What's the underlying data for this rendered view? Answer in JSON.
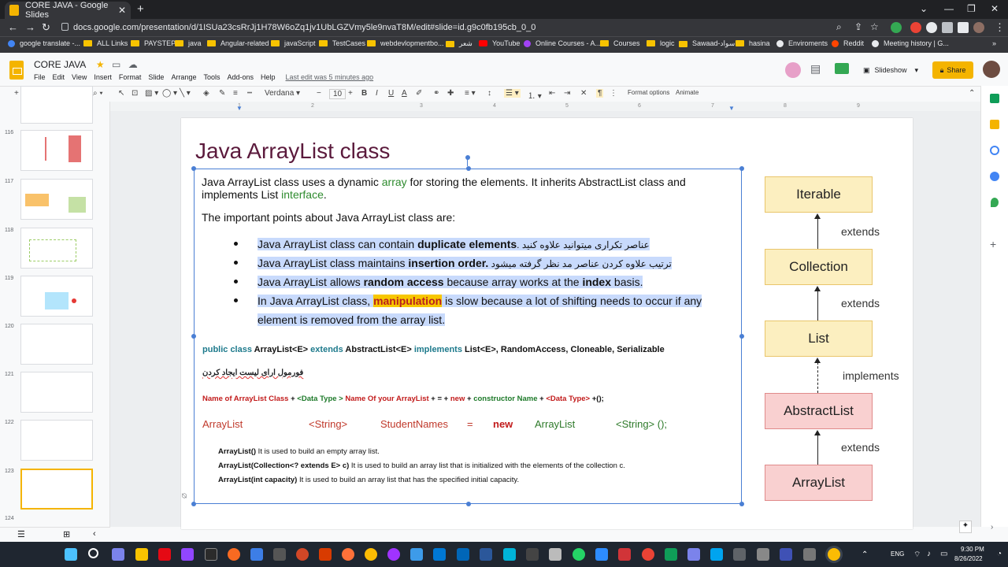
{
  "browser": {
    "tab_title": "CORE JAVA - Google Slides",
    "url": "docs.google.com/presentation/d/1ISUa23csRrJj1H78W6oZq1jv1UbLGZVmy5le9nvaT8M/edit#slide=id.g9c0fb195cb_0_0",
    "new_tab": "+",
    "tab_close": "✕"
  },
  "bookmarks": [
    {
      "label": "google translate -..."
    },
    {
      "label": "ALL Links"
    },
    {
      "label": "PAYSTEP"
    },
    {
      "label": "java"
    },
    {
      "label": "Angular-related"
    },
    {
      "label": "javaScript"
    },
    {
      "label": "TestCases"
    },
    {
      "label": "webdevlopmentbo..."
    },
    {
      "label": "شعر"
    },
    {
      "label": "YouTube"
    },
    {
      "label": "Online Courses - A..."
    },
    {
      "label": "Courses"
    },
    {
      "label": "logic"
    },
    {
      "label": "Sawaad-سواد"
    },
    {
      "label": "hasina"
    },
    {
      "label": "Enviroments"
    },
    {
      "label": "Reddit"
    },
    {
      "label": "Meeting history | G..."
    }
  ],
  "app": {
    "doc_title": "CORE JAVA",
    "menu": [
      "File",
      "Edit",
      "View",
      "Insert",
      "Format",
      "Slide",
      "Arrange",
      "Tools",
      "Add-ons",
      "Help"
    ],
    "last_edit": "Last edit was 5 minutes ago",
    "slideshow": "Slideshow",
    "share": "Share"
  },
  "toolbar": {
    "font": "Verdana",
    "size": "10",
    "format_options": "Format options",
    "animate": "Animate"
  },
  "ruler": [
    "1",
    "2",
    "3",
    "4",
    "5",
    "6",
    "7",
    "8",
    "9"
  ],
  "slides": [
    {
      "num": "116"
    },
    {
      "num": "117"
    },
    {
      "num": "118"
    },
    {
      "num": "119"
    },
    {
      "num": "120"
    },
    {
      "num": "121"
    },
    {
      "num": "122"
    },
    {
      "num": "123"
    },
    {
      "num": "124"
    }
  ],
  "slide": {
    "title": "Java ArrayList class",
    "intro_a": "Java ArrayList class uses a dynamic ",
    "intro_array": "array",
    "intro_b": " for storing the elements. It inherits AbstractList class and",
    "intro_c": "implements List ",
    "intro_interface": "interface",
    "intro_d": ".",
    "points_heading": "The important points about Java ArrayList class are:",
    "b1a": "Java ArrayList class can contain ",
    "b1b": "duplicate elements",
    "b1c": ". عناصر تکراری میتوانید علاوه کنید",
    "b2a": "Java ArrayList class maintains ",
    "b2b": "insertion order.",
    "b2c": " ترتیب علاوه کردن عناصر مد نظر گرفته میشود",
    "b3a": "Java ArrayList allows ",
    "b3b": "random access",
    "b3c": " because array works at the ",
    "b3d": "index",
    "b3e": " basis.",
    "b4a": "In Java ArrayList class, ",
    "b4b": "manipulation",
    "b4c": " is slow because a lot of shifting needs to occur if any",
    "b4d": "element is removed from the array list.",
    "decl_public": "public class ",
    "decl_arraylist": "ArrayList<E> ",
    "decl_extends": "extends ",
    "decl_abstract": "AbstractList<E> ",
    "decl_implements": "implements ",
    "decl_rest": "List<E>, RandomAccess, Cloneable, Serializable",
    "formula_fa": "فورمول ارای لیست ایجاد کردن",
    "f1": "Name of ArrayList Class",
    "f2": " + ",
    "f3": "<Data Type > ",
    "f4": "Name Of your ArrayList",
    "f5": " + = + ",
    "f6": "new",
    "f7": " + ",
    "f8": "constructor Name ",
    "f9": " + ",
    "f10": "<Data Type>",
    "f11": " +();",
    "r1": "ArrayList",
    "r2": "<String>",
    "r3": "StudentNames",
    "r4": "=",
    "r5": "new",
    "r6": "ArrayList",
    "r7": "<String> ();",
    "c1a": "ArrayList()",
    "c1b": "  It is used to build an empty array list.",
    "c2a": "ArrayList(Collection<? extends E> c)",
    "c2b": " It is used to build an array list that is initialized with the elements of the collection c.",
    "c3a": "ArrayList(int capacity)",
    "c3b": " It is used to build an array list that has the specified initial capacity."
  },
  "hierarchy": {
    "boxes": [
      "Iterable",
      "Collection",
      "List",
      "AbstractList",
      "ArrayList"
    ],
    "labels": [
      "extends",
      "extends",
      "implements",
      "extends"
    ]
  },
  "taskbar": {
    "lang": "ENG",
    "time": "9:30 PM",
    "date": "8/26/2022"
  }
}
